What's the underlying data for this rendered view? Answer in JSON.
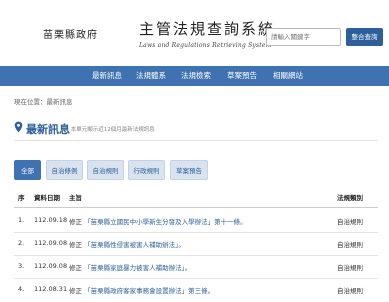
{
  "header": {
    "county": "苗栗縣政府",
    "title": "主管法規查詢系統",
    "subtitle": "Laws and Regulations Retrieving System",
    "search_placeholder": "請輸入關鍵字",
    "search_button": "整合查詢"
  },
  "nav": {
    "items": [
      "最新訊息",
      "法規體系",
      "法規檢索",
      "草案預告",
      "相關網站"
    ]
  },
  "breadcrumb": "現在位置：最新訊息",
  "section": {
    "title": "最新訊息",
    "note": "- 本單元顯示近12個月最新法規訊息"
  },
  "tabs": [
    "全部",
    "自治條例",
    "自治規則",
    "行政規則",
    "草案預告"
  ],
  "table": {
    "headers": {
      "no": "序",
      "date": "資料日期",
      "subject": "主旨",
      "category": "法規類別"
    },
    "rows": [
      {
        "no": "1.",
        "date": "112.09.18",
        "action": "修正",
        "title": "「苗栗縣立國民中小學新生分發及入學辦法」第十一條。",
        "category": "自治規則"
      },
      {
        "no": "2.",
        "date": "112.09.08",
        "action": "修正",
        "title": "「苗栗縣性侵害被害人補助辦法」。",
        "category": "自治規則"
      },
      {
        "no": "3.",
        "date": "112.09.08",
        "action": "修正",
        "title": "「苗栗縣家庭暴力被害人補助辦法」。",
        "category": "自治規則"
      },
      {
        "no": "4.",
        "date": "112.08.31",
        "action": "修正",
        "title": "「苗栗縣政府客家事務會設置辦法」第三條。",
        "category": "自治規則"
      }
    ]
  },
  "colors": {
    "brand": "#3e72b0",
    "link": "#2c5f9c"
  }
}
